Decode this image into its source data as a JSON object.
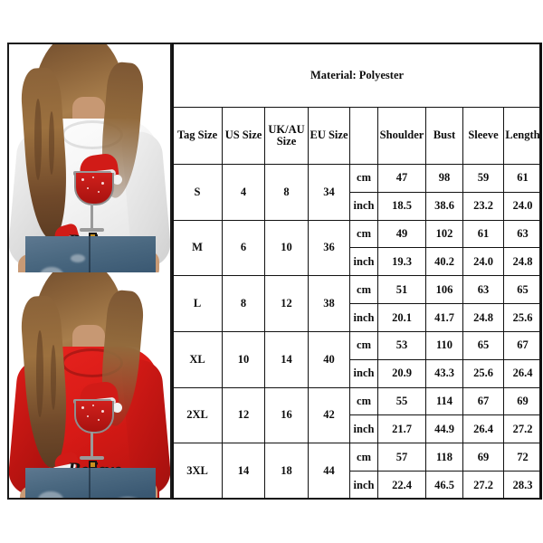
{
  "document": {
    "type": "product-size-chart",
    "title": "Material: Polyester"
  },
  "photos": [
    {
      "name": "white-sweatshirt-photo",
      "garment_color": "#f2f2f2",
      "garment_label": "white",
      "graphic_text": "Believe",
      "graphic_motif": "santa-hat-wine-glass",
      "bottoms": "distressed blue jeans"
    },
    {
      "name": "red-sweatshirt-photo",
      "garment_color": "#d81a16",
      "garment_label": "red",
      "graphic_text": "Believe",
      "graphic_motif": "santa-hat-wine-glass",
      "bottoms": "distressed blue jeans"
    }
  ],
  "table": {
    "material_row": "Material: Polyester",
    "headers": {
      "tag_size": "Tag Size",
      "us_size": "US Size",
      "uk_au_size": "UK/AU Size",
      "eu_size": "EU Size",
      "unit": "",
      "shoulder": "Shoulder",
      "bust": "Bust",
      "sleeve": "Sleeve",
      "length": "Length"
    },
    "unit_labels": {
      "cm": "cm",
      "inch": "inch"
    },
    "shading": {
      "inch_row_bg": "#c4c4c4",
      "border": "#111111"
    },
    "rows": [
      {
        "tag": "S",
        "us": "4",
        "uk_au": "8",
        "eu": "34",
        "cm": {
          "shoulder": "47",
          "bust": "98",
          "sleeve": "59",
          "length": "61"
        },
        "inch": {
          "shoulder": "18.5",
          "bust": "38.6",
          "sleeve": "23.2",
          "length": "24.0"
        }
      },
      {
        "tag": "M",
        "us": "6",
        "uk_au": "10",
        "eu": "36",
        "cm": {
          "shoulder": "49",
          "bust": "102",
          "sleeve": "61",
          "length": "63"
        },
        "inch": {
          "shoulder": "19.3",
          "bust": "40.2",
          "sleeve": "24.0",
          "length": "24.8"
        }
      },
      {
        "tag": "L",
        "us": "8",
        "uk_au": "12",
        "eu": "38",
        "cm": {
          "shoulder": "51",
          "bust": "106",
          "sleeve": "63",
          "length": "65"
        },
        "inch": {
          "shoulder": "20.1",
          "bust": "41.7",
          "sleeve": "24.8",
          "length": "25.6"
        }
      },
      {
        "tag": "XL",
        "us": "10",
        "uk_au": "14",
        "eu": "40",
        "cm": {
          "shoulder": "53",
          "bust": "110",
          "sleeve": "65",
          "length": "67"
        },
        "inch": {
          "shoulder": "20.9",
          "bust": "43.3",
          "sleeve": "25.6",
          "length": "26.4"
        }
      },
      {
        "tag": "2XL",
        "us": "12",
        "uk_au": "16",
        "eu": "42",
        "cm": {
          "shoulder": "55",
          "bust": "114",
          "sleeve": "67",
          "length": "69"
        },
        "inch": {
          "shoulder": "21.7",
          "bust": "44.9",
          "sleeve": "26.4",
          "length": "27.2"
        }
      },
      {
        "tag": "3XL",
        "us": "14",
        "uk_au": "18",
        "eu": "44",
        "cm": {
          "shoulder": "57",
          "bust": "118",
          "sleeve": "69",
          "length": "72"
        },
        "inch": {
          "shoulder": "22.4",
          "bust": "46.5",
          "sleeve": "27.2",
          "length": "28.3"
        }
      }
    ]
  }
}
